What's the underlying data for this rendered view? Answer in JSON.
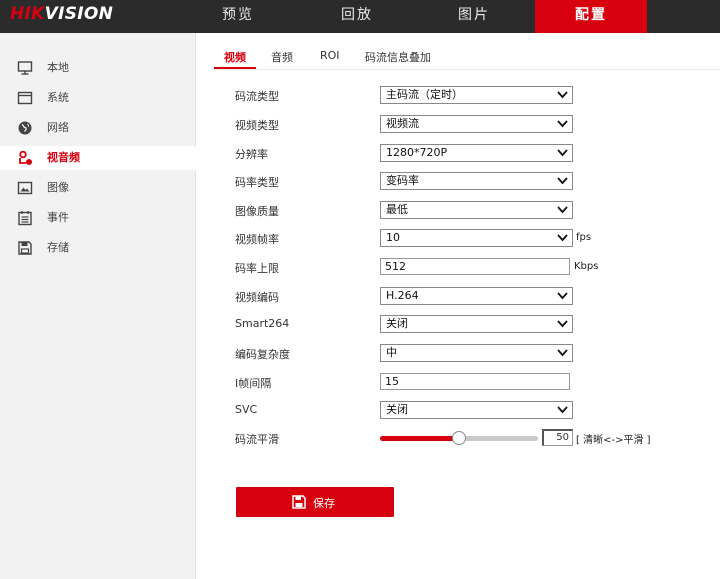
{
  "header": {
    "logo_prefix": "HIK",
    "logo_suffix": "VISION",
    "nav": [
      {
        "label": "预览"
      },
      {
        "label": "回放"
      },
      {
        "label": "图片"
      },
      {
        "label": "配置"
      }
    ],
    "active_nav": "配置"
  },
  "sidebar": {
    "items": [
      {
        "label": "本地",
        "icon": "monitor-icon"
      },
      {
        "label": "系统",
        "icon": "window-icon"
      },
      {
        "label": "网络",
        "icon": "globe-icon"
      },
      {
        "label": "视音频",
        "icon": "camera-mic-icon"
      },
      {
        "label": "图像",
        "icon": "image-icon"
      },
      {
        "label": "事件",
        "icon": "calendar-icon"
      },
      {
        "label": "存储",
        "icon": "floppy-disk-icon"
      }
    ],
    "active_item": "视音频"
  },
  "subtabs": [
    {
      "label": "视频"
    },
    {
      "label": "音频"
    },
    {
      "label": "ROI"
    },
    {
      "label": "码流信息叠加"
    }
  ],
  "form": {
    "stream_type": {
      "label": "码流类型",
      "value": "主码流（定时）"
    },
    "video_type": {
      "label": "视频类型",
      "value": "视频流"
    },
    "resolution": {
      "label": "分辨率",
      "value": "1280*720P"
    },
    "bitrate_type": {
      "label": "码率类型",
      "value": "变码率"
    },
    "image_quality": {
      "label": "图像质量",
      "value": "最低"
    },
    "frame_rate": {
      "label": "视频帧率",
      "value": "10",
      "unit": "fps"
    },
    "max_bitrate": {
      "label": "码率上限",
      "value": "512",
      "unit": "Kbps"
    },
    "video_encoding": {
      "label": "视频编码",
      "value": "H.264"
    },
    "smart264": {
      "label": "Smart264",
      "value": "关闭"
    },
    "encoding_complexity": {
      "label": "编码复杂度",
      "value": "中"
    },
    "i_frame_interval": {
      "label": "I帧间隔",
      "value": "15"
    },
    "svc": {
      "label": "SVC",
      "value": "关闭"
    },
    "stream_smoothing": {
      "label": "码流平滑",
      "value": "50",
      "percent": 50,
      "note": "[ 清晰<->平滑 ]"
    }
  },
  "save_button": {
    "label": "保存"
  },
  "colors": {
    "accent": "#d7000f",
    "topbar": "#2b2b2b",
    "sidebar": "#f2f2f2"
  }
}
